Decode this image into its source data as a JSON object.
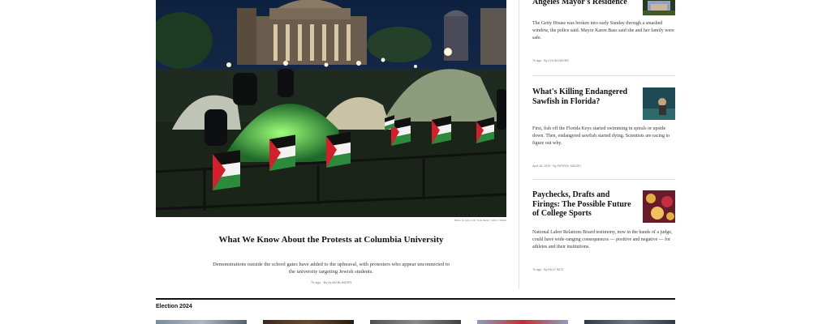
{
  "lead": {
    "headline": "What We Know About the Protests at Columbia University",
    "summary": "Demonstrations outside the school gates have added to the upheaval, with protesters who appear unconnected to the university targeting Jewish students.",
    "meta": "7h ago  ·  By ALAN BLINDER",
    "photo_credit": "BING GUAN FOR THE NEW YORK TIMES"
  },
  "stories": [
    {
      "title": "Angeles Mayor's Residence",
      "summary": "The Getty House was broken into early Sunday through a smashed window, the police said. Mayor Karen Bass said she and her family were safe.",
      "meta": "7h ago  ·  By COLIN DWYER"
    },
    {
      "title": "What's Killing Endangered Sawfish in Florida?",
      "summary": "First, fish off the Florida Keys started swimming in spirals or upside down. Then, endangered sawfish started dying. Scientists are racing to figure out why.",
      "meta": "April 18, 2024  ·  By PATRICK MAZZEI"
    },
    {
      "title": "Paychecks, Drafts and Firings: The Possible Future of College Sports",
      "summary": "National Labor Relations Board testimony, now in the hands of a judge, could have wide-ranging consequences — positive and negative — for athletes and their institutions.",
      "meta": "7h ago  ·  By BILLY WITZ"
    }
  ],
  "section": {
    "label": "Election 2024"
  }
}
